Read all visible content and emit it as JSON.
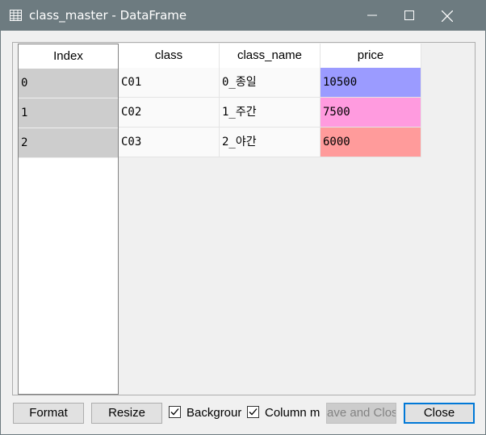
{
  "window": {
    "title": "class_master - DataFrame",
    "icon": "table-icon",
    "controls": [
      "minimize-icon",
      "maximize-icon",
      "close-icon"
    ]
  },
  "index": {
    "header": "Index",
    "values": [
      "0",
      "1",
      "2"
    ]
  },
  "table": {
    "columns": [
      "class",
      "class_name",
      "price"
    ],
    "rows": [
      [
        "C01",
        "0_종일",
        "10500"
      ],
      [
        "C02",
        "1_주간",
        "7500"
      ],
      [
        "C03",
        "2_야간",
        "6000"
      ]
    ],
    "price_colors": [
      "#9b9bff",
      "#ff9bdf",
      "#ff9b9b"
    ]
  },
  "footer": {
    "format_label": "Format",
    "resize_label": "Resize",
    "background_label": "Backgrour",
    "background_checked": true,
    "column_min_label": "Column mi",
    "column_min_checked": true,
    "save_close_label": "ave and Clos",
    "close_label": "Close"
  }
}
